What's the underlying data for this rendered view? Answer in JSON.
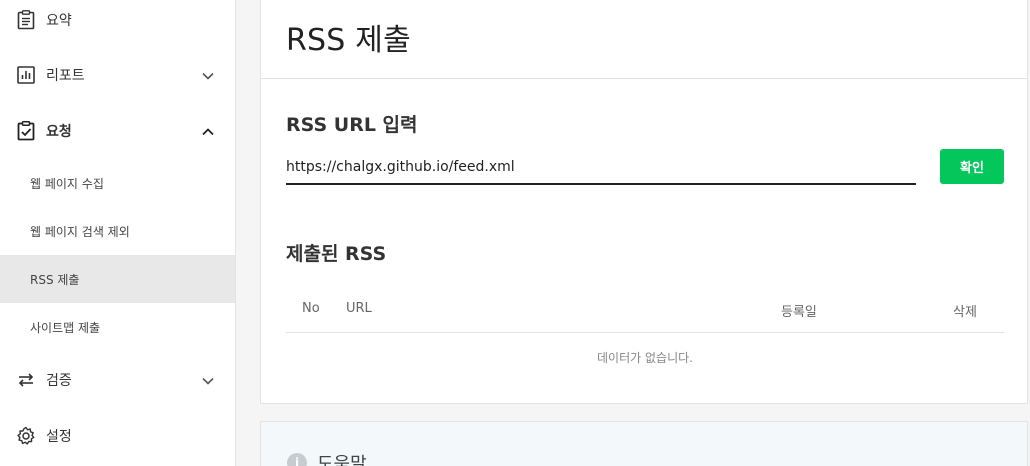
{
  "sidebar": {
    "summary": {
      "label": "요약",
      "icon": "clipboard-icon"
    },
    "reports": {
      "label": "리포트",
      "icon": "bar-chart-icon"
    },
    "requests": {
      "label": "요청",
      "icon": "clipboard-check-icon",
      "items": [
        {
          "label": "웹 페이지 수집"
        },
        {
          "label": "웹 페이지 검색 제외"
        },
        {
          "label": "RSS 제출",
          "active": true
        },
        {
          "label": "사이트맵 제출"
        }
      ]
    },
    "verify": {
      "label": "검증",
      "icon": "swap-arrows-icon"
    },
    "settings": {
      "label": "설정",
      "icon": "gear-icon"
    }
  },
  "main": {
    "title": "RSS 제출",
    "input_section": {
      "title": "RSS URL 입력",
      "value": "https://chalgx.github.io/feed.xml",
      "button": "확인"
    },
    "submitted": {
      "title": "제출된 RSS",
      "columns": [
        "No",
        "URL",
        "등록일",
        "삭제"
      ],
      "empty": "데이터가 없습니다."
    }
  },
  "help": {
    "title": "도움말",
    "icon_glyph": "i"
  },
  "colors": {
    "accent": "#03c75a",
    "active_bg": "#e8e8e8",
    "help_bg": "#f3f8fa"
  }
}
